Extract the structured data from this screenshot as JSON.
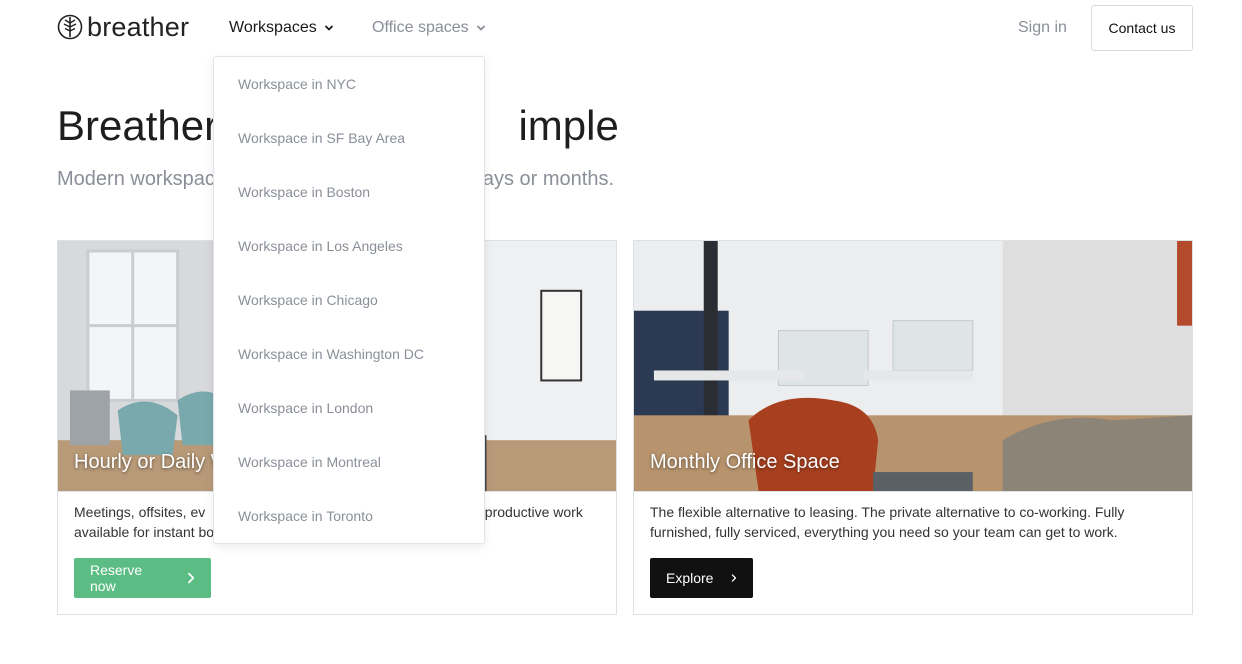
{
  "header": {
    "logo_text": "breather",
    "nav": {
      "workspaces_label": "Workspaces",
      "office_spaces_label": "Office spaces"
    },
    "sign_in_label": "Sign in",
    "contact_label": "Contact us"
  },
  "hero": {
    "title_left": "Breather,",
    "title_right": "imple",
    "subtitle_left": "Modern workspac",
    "subtitle_right": "ays or months."
  },
  "cards": [
    {
      "title": "Hourly or Daily W",
      "body_line1_left": "Meetings, offsites, ev",
      "body_line1_right": "r productive work",
      "body_line2": "available for instant bo",
      "button_label": "Reserve now",
      "button_color": "#5cbd84"
    },
    {
      "title": "Monthly Office Space",
      "body": "The flexible alternative to leasing. The private alternative to co-working. Fully furnished, fully serviced, everything you need so your team can get to work.",
      "button_label": "Explore",
      "button_color": "#111111"
    }
  ],
  "dropdown": {
    "items": [
      "Workspace in NYC",
      "Workspace in SF Bay Area",
      "Workspace in Boston",
      "Workspace in Los Angeles",
      "Workspace in Chicago",
      "Workspace in Washington DC",
      "Workspace in London",
      "Workspace in Montreal",
      "Workspace in Toronto"
    ]
  },
  "icons": {
    "logo": "breather-leaf-icon",
    "nav_chevron": "chevron-down-icon",
    "button_chevron": "chevron-right-icon"
  },
  "colors": {
    "accent_green": "#5cbd84",
    "muted_text": "#8a8f98",
    "dark_button": "#111111"
  }
}
